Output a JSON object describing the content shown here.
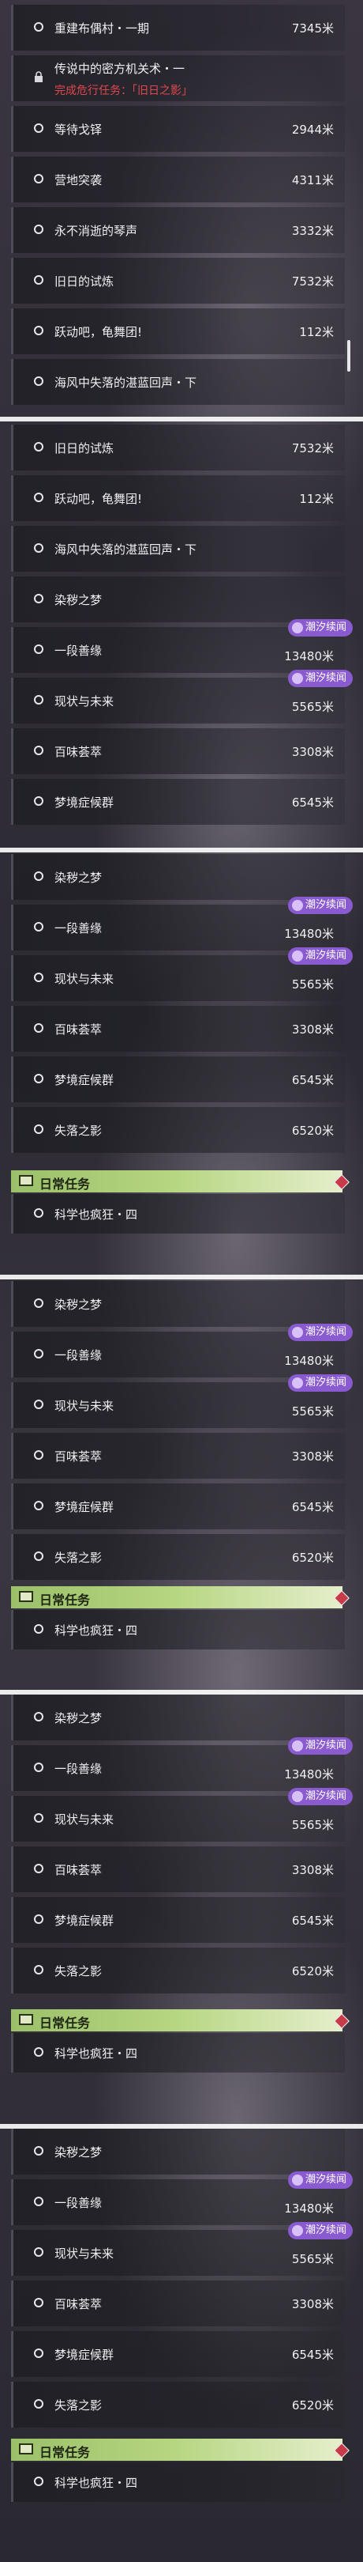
{
  "panel1": {
    "rows": [
      {
        "name": "重建布偶村・一期",
        "dist": "7345米"
      },
      {
        "name": "传说中的密方机关术・一",
        "dist": "",
        "warning": "完成危行任务：「旧日之影」"
      },
      {
        "name": "等待戈铎",
        "dist": "2944米"
      },
      {
        "name": "营地突袭",
        "dist": "4311米"
      },
      {
        "name": "永不消逝的琴声",
        "dist": "3332米"
      },
      {
        "name": "旧日的试炼",
        "dist": "7532米"
      },
      {
        "name": "跃动吧，龟舞团!",
        "dist": "112米"
      },
      {
        "name": "海风中失落的湛蓝回声・下",
        "dist": ""
      }
    ]
  },
  "panel2": {
    "rows": [
      {
        "name": "旧日的试炼",
        "dist": "7532米"
      },
      {
        "name": "跃动吧，龟舞团!",
        "dist": "112米"
      },
      {
        "name": "海风中失落的湛蓝回声・下",
        "dist": ""
      },
      {
        "name": "染秽之梦",
        "dist": ""
      },
      {
        "name": "一段善缘",
        "dist": "13480米",
        "badge": "潮汐续闻"
      },
      {
        "name": "现状与未来",
        "dist": "5565米",
        "badge": "潮汐续闻"
      },
      {
        "name": "百味荟萃",
        "dist": "3308米"
      },
      {
        "name": "梦境症候群",
        "dist": "6545米"
      }
    ]
  },
  "panel3": {
    "rows": [
      {
        "name": "染秽之梦",
        "dist": ""
      },
      {
        "name": "一段善缘",
        "dist": "13480米",
        "badge": "潮汐续闻"
      },
      {
        "name": "现状与未来",
        "dist": "5565米",
        "badge": "潮汐续闻"
      },
      {
        "name": "百味荟萃",
        "dist": "3308米"
      },
      {
        "name": "梦境症候群",
        "dist": "6545米"
      },
      {
        "name": "失落之影",
        "dist": "6520米"
      }
    ],
    "header": "日常任务",
    "daily": "科学也疯狂・四"
  },
  "panel4": {
    "rows": [
      {
        "name": "染秽之梦",
        "dist": ""
      },
      {
        "name": "一段善缘",
        "dist": "13480米",
        "badge": "潮汐续闻"
      },
      {
        "name": "现状与未来",
        "dist": "5565米",
        "badge": "潮汐续闻"
      },
      {
        "name": "百味荟萃",
        "dist": "3308米"
      },
      {
        "name": "梦境症候群",
        "dist": "6545米"
      },
      {
        "name": "失落之影",
        "dist": "6520米"
      }
    ],
    "header": "日常任务",
    "daily": "科学也疯狂・四"
  },
  "panel5": {
    "rows": [
      {
        "name": "染秽之梦",
        "dist": ""
      },
      {
        "name": "一段善缘",
        "dist": "13480米",
        "badge": "潮汐续闻"
      },
      {
        "name": "现状与未来",
        "dist": "5565米",
        "badge": "潮汐续闻"
      },
      {
        "name": "百味荟萃",
        "dist": "3308米"
      },
      {
        "name": "梦境症候群",
        "dist": "6545米"
      },
      {
        "name": "失落之影",
        "dist": "6520米"
      }
    ],
    "header": "日常任务",
    "daily": "科学也疯狂・四"
  },
  "panel6": {
    "rows": [
      {
        "name": "染秽之梦",
        "dist": ""
      },
      {
        "name": "一段善缘",
        "dist": "13480米",
        "badge": "潮汐续闻"
      },
      {
        "name": "现状与未来",
        "dist": "5565米",
        "badge": "潮汐续闻"
      },
      {
        "name": "百味荟萃",
        "dist": "3308米"
      },
      {
        "name": "梦境症候群",
        "dist": "6545米"
      },
      {
        "name": "失落之影",
        "dist": "6520米"
      }
    ],
    "header": "日常任务",
    "daily": "科学也疯狂・四"
  }
}
